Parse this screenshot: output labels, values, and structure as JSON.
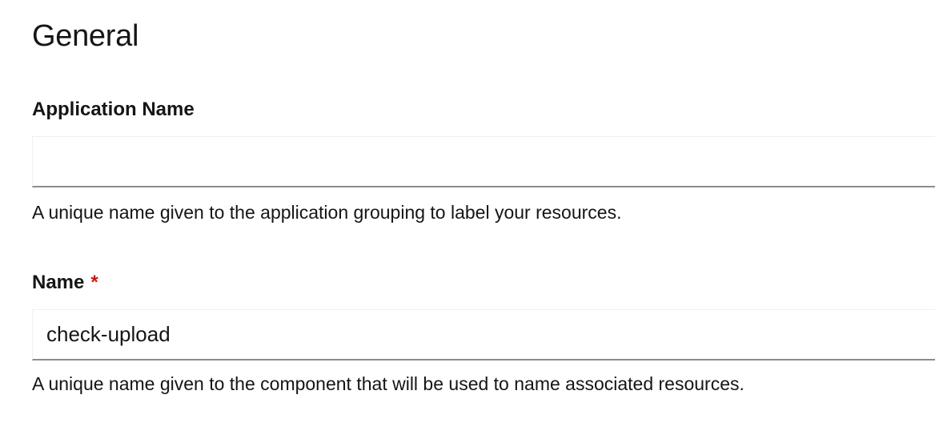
{
  "section": {
    "title": "General"
  },
  "fields": {
    "application_name": {
      "label": "Application Name",
      "value": "",
      "placeholder": "",
      "helper": "A unique name given to the application grouping to label your resources."
    },
    "name": {
      "label": "Name",
      "required_marker": "*",
      "value": "check-upload",
      "helper": "A unique name given to the component that will be used to name associated resources."
    }
  }
}
